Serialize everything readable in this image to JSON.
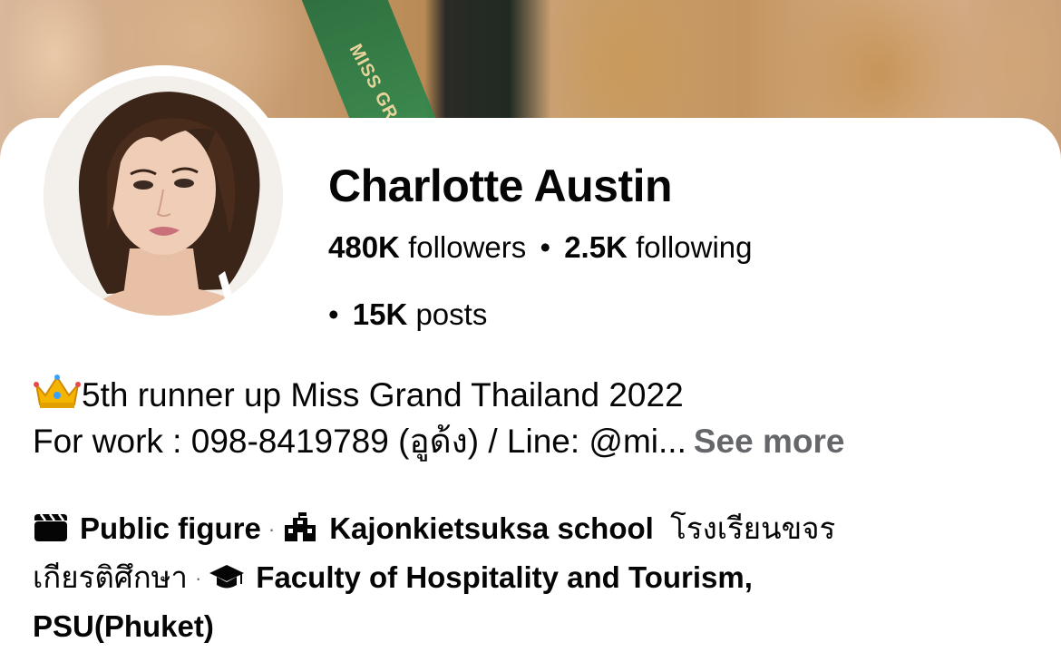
{
  "profile": {
    "name": "Charlotte Austin",
    "followers_count": "480K",
    "followers_label": "followers",
    "following_count": "2.5K",
    "following_label": "following",
    "posts_count": "15K",
    "posts_label": "posts",
    "separator": "•"
  },
  "cover": {
    "sash_text": "MISS GRA"
  },
  "bio": {
    "line1": "5th runner up Miss Grand Thailand 2022",
    "line2": "For work : 098-8419789 (อูด้ง) / Line: @mi...",
    "see_more": "See more",
    "crown_icon": "crown-emoji-icon"
  },
  "about": {
    "category": "Public figure",
    "school_en": "Kajonkietsuksa school",
    "school_th_1": "โรงเรียนขจร",
    "school_th_2": "เกียรติศึกษา",
    "university": "Faculty of Hospitality and Tourism,",
    "university_2": "PSU(Phuket)",
    "separator": "·",
    "icons": [
      "clapperboard-icon",
      "school-building-icon",
      "graduation-cap-icon"
    ]
  },
  "colors": {
    "text": "#050505",
    "secondary": "#65676b",
    "crown": "#f4b400"
  }
}
